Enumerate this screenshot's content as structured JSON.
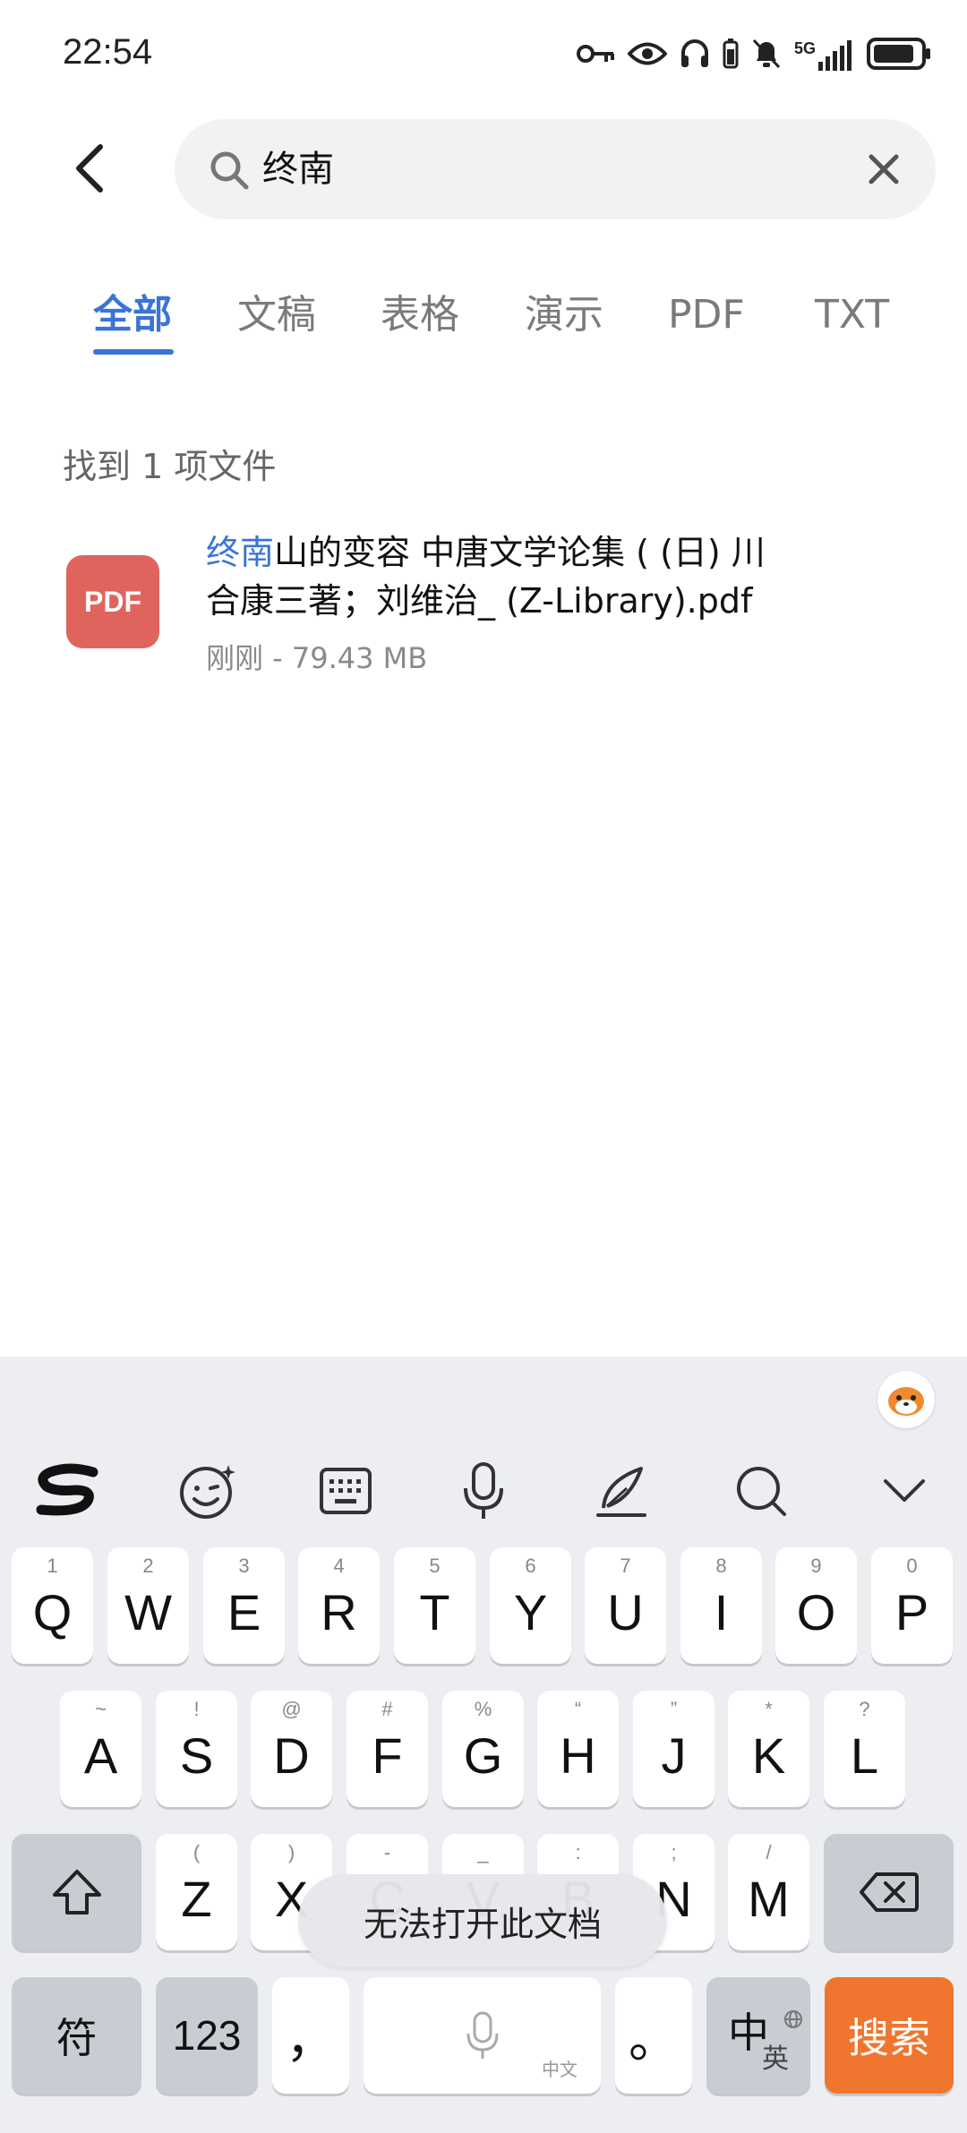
{
  "status_bar": {
    "time": "22:54",
    "network": "5G"
  },
  "search": {
    "query": "终南"
  },
  "tabs": [
    {
      "label": "全部",
      "active": true
    },
    {
      "label": "文稿"
    },
    {
      "label": "表格"
    },
    {
      "label": "演示"
    },
    {
      "label": "PDF"
    },
    {
      "label": "TXT"
    }
  ],
  "results": {
    "summary": "找到 1 项文件",
    "files": [
      {
        "icon_label": "PDF",
        "name_highlight": "终南",
        "name_rest_line1": "山的变容 中唐文学论集 ( (日) 川",
        "name_line2": "合康三著；刘维治_ (Z-Library).pdf",
        "meta": "刚刚 - 79.43 MB"
      }
    ]
  },
  "keyboard": {
    "row1": [
      {
        "hint": "1",
        "key": "Q"
      },
      {
        "hint": "2",
        "key": "W"
      },
      {
        "hint": "3",
        "key": "E"
      },
      {
        "hint": "4",
        "key": "R"
      },
      {
        "hint": "5",
        "key": "T"
      },
      {
        "hint": "6",
        "key": "Y"
      },
      {
        "hint": "7",
        "key": "U"
      },
      {
        "hint": "8",
        "key": "I"
      },
      {
        "hint": "9",
        "key": "O"
      },
      {
        "hint": "0",
        "key": "P"
      }
    ],
    "row2": [
      {
        "hint": "~",
        "key": "A"
      },
      {
        "hint": "!",
        "key": "S"
      },
      {
        "hint": "@",
        "key": "D"
      },
      {
        "hint": "#",
        "key": "F"
      },
      {
        "hint": "%",
        "key": "G"
      },
      {
        "hint": "“",
        "key": "H"
      },
      {
        "hint": "”",
        "key": "J"
      },
      {
        "hint": "*",
        "key": "K"
      },
      {
        "hint": "?",
        "key": "L"
      }
    ],
    "row3": [
      {
        "hint": "(",
        "key": "Z"
      },
      {
        "hint": ")",
        "key": "X"
      },
      {
        "hint": "-",
        "key": "C"
      },
      {
        "hint": "_",
        "key": "V"
      },
      {
        "hint": ":",
        "key": "B"
      },
      {
        "hint": ";",
        "key": "N"
      },
      {
        "hint": "/",
        "key": "M"
      }
    ],
    "symbols_label": "符",
    "numbers_label": "123",
    "comma_label": "，",
    "space_label": "中文",
    "period_label": "。",
    "lang_main": "中",
    "lang_sub": "英",
    "search_label": "搜索"
  },
  "toast": "无法打开此文档"
}
